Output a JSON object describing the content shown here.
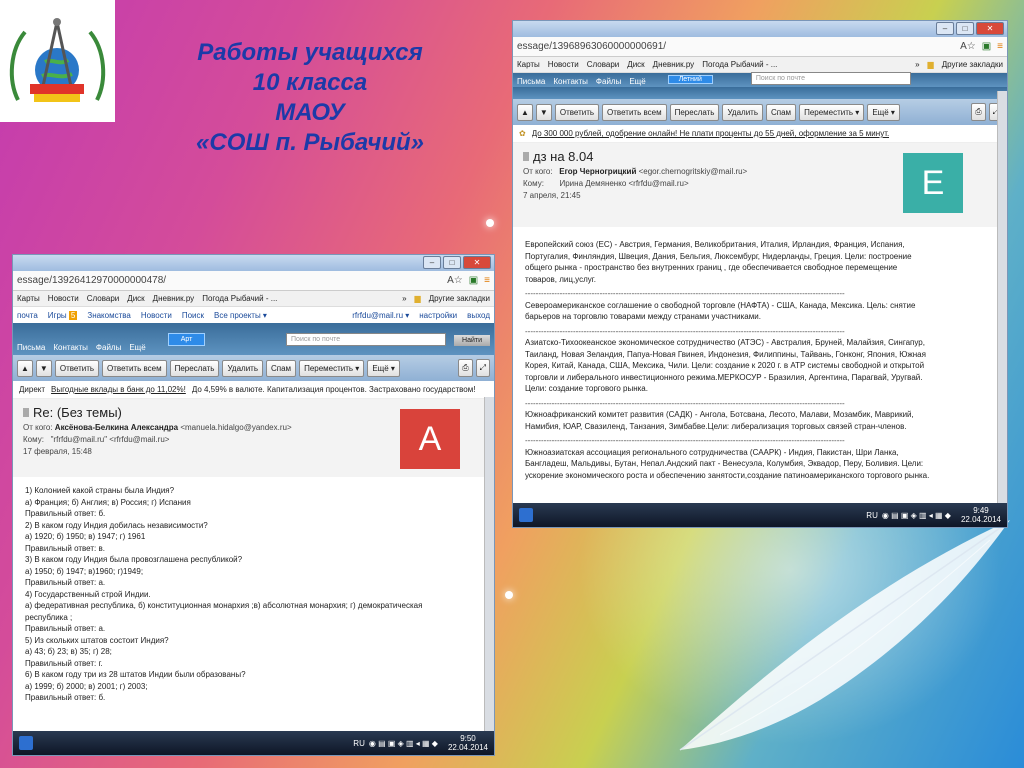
{
  "slide": {
    "title_lines": [
      "Работы  учащихся",
      "10 класса",
      "МАОУ",
      "«СОШ  п. Рыбачий»"
    ]
  },
  "icons": {
    "logo": "school-compass-globe-logo",
    "feather": "feather-decoration",
    "minimize": "minimize-icon",
    "maximize": "maximize-icon",
    "close": "close-icon",
    "star": "bookmark-star-icon",
    "menu": "menu-icon",
    "folder": "folder-icon"
  },
  "colors": {
    "avatar_a": "#d9433b",
    "avatar_e": "#3aafa7",
    "title": "#1c3aa8"
  },
  "win_left": {
    "url": "essage/13926412970000000478/",
    "url_icons": "A☆",
    "bookmarks": [
      "Карты",
      "Новости",
      "Словари",
      "Диск",
      "Дневник.ру",
      "Погода Рыбачий - ..."
    ],
    "bookmarks_more": "»",
    "other_bookmarks": "Другие закладки",
    "nav": [
      "почта",
      "Игры",
      "Знакомства",
      "Новости",
      "Поиск",
      "Все проекты ▾"
    ],
    "nav_games_badge": "5",
    "nav_right": [
      "rfrfdu@mail.ru ▾",
      "настройки",
      "выход"
    ],
    "tabs": [
      "Письма",
      "Контакты",
      "Файлы",
      "Ещё"
    ],
    "tab_badge": "Арт",
    "search_placeholder": "Поиск по почте",
    "search_btn": "Найти",
    "toolbar": [
      "Ответить",
      "Ответить всем",
      "Переслать",
      "Удалить",
      "Спам",
      "Переместить ▾",
      "Ещё ▾"
    ],
    "ad_label": "Директ",
    "ad_text": "Выгодные вклады в банк до 11,02%!",
    "ad_text2": "До 4,59% в валюте. Капитализация процентов. Застраховано государством!",
    "subject": "Re: (Без темы)",
    "from_label": "От кого:",
    "from_name": "Аксёнова-Белкина Александра",
    "from_email": "<manuela.hidalgo@yandex.ru>",
    "to_label": "Кому:",
    "to_value": "\"rfrfdu@mail.ru\" <rfrfdu@mail.ru>",
    "date": "17 февраля, 15:48",
    "avatar": "A",
    "body": [
      "1) Колонией какой страны была Индия?",
      "а) Франция; б) Англия; в) Россия; г) Испания",
      "Правильный ответ: б.",
      "2) В каком году Индия добилась независимости?",
      "а) 1920; б) 1950; в) 1947; г) 1961",
      "Правильный ответ: в.",
      "3) В каком году Индия была провозглашена республикой?",
      "а) 1950; б) 1947; в)1960; г)1949;",
      "Правильный ответ: а.",
      "4) Государственный строй Индии.",
      "а) федеративная республика, б) конституционная монархия ;в) абсолютная монархия; г) демократическая",
      "республика ;",
      "Правильный ответ: а.",
      "5) Из скольких штатов состоит Индия?",
      "а) 43; б) 23; в) 35; г) 28;",
      "Правильный ответ: г.",
      "6) В каком году три из 28 штатов Индии были образованы?",
      "а) 1999; б) 2000; в) 2001; г) 2003;",
      "Правильный ответ: б."
    ],
    "lang": "RU",
    "time": "9:50",
    "date_taskbar": "22.04.2014"
  },
  "win_right": {
    "url": "essage/13968963060000000691/",
    "url_icons": "A☆",
    "bookmarks": [
      "Карты",
      "Новости",
      "Словари",
      "Диск",
      "Дневник.ру",
      "Погода Рыбачий - ..."
    ],
    "bookmarks_more": "»",
    "other_bookmarks": "Другие закладки",
    "tabs": [
      "Письма",
      "Контакты",
      "Файлы",
      "Ещё"
    ],
    "tab_badge": "Летний",
    "search_placeholder": "Поиск по почте",
    "toolbar": [
      "Ответить",
      "Ответить всем",
      "Переслать",
      "Удалить",
      "Спам",
      "Переместить ▾",
      "Ещё ▾"
    ],
    "ad_text": "До 300 000 рублей, одобрение онлайн! Не плати проценты до 55 дней, оформление за 5 минут.",
    "subject": "дз на 8.04",
    "from_label": "От кого:",
    "from_name": "Егор Черногрицкий",
    "from_email": "<egor.chernogritskiy@mail.ru>",
    "to_label": "Кому:",
    "to_value": "Ирина Демяненко <rfrfdu@mail.ru>",
    "date": "7 апреля, 21:45",
    "avatar": "E",
    "paragraphs": [
      [
        "Европейский союз (ЕС) - Австрия, Германия, Великобритания, Италия, Ирландия, Франция, Испания,",
        "Португалия, Финляндия, Швеция, Дания, Бельгия, Люксембург, Нидерланды, Греция. Цели: построение",
        "общего рынка - пространство без внутренних границ , где обеспечивается свободное перемещение",
        "товаров, лиц,услуг."
      ],
      [
        "Североамериканское соглашение о свободной торговле (НАФТА) - США, Канада, Мексика. Цель: снятие",
        "барьеров на торговлю товарами между странами участниками."
      ],
      [
        "Азиатско-Тихоокеанское экономическое сотрудничество (АТЭС) - Австралия, Бруней, Малайзия, Сингапур,",
        "Таиланд, Новая Зеландия, Папуа-Новая Гвинея, Индонезия, Филиппины, Тайвань, Гонконг, Япония, Южная",
        "Корея, Китай, Канада, США, Мексика, Чили. Цели: создание к 2020 г. в АТР системы свободной и открытой",
        "торговли и либерального инвестиционного режима.МЕРКОСУР - Бразилия, Аргентина, Парагвай, Уругвай.",
        "Цели: создание торгового рынка."
      ],
      [
        "Южноафриканский комитет развития (САДК) - Ангола, Ботсвана, Лесото, Малави, Мозамбик, Маврикий,",
        "Намибия, ЮАР, Свазиленд, Танзания, Зимбабве.Цели: либерализация торговых связей стран-членов."
      ],
      [
        "Южноазиатская ассоциация регионального сотрудничества (СААРК) - Индия, Пакистан, Шри Ланка,",
        "Бангладеш, Мальдивы, Бутан, Непал.Андский пакт - Венесуэла, Колумбия, Эквадор, Перу, Боливия. Цели:",
        "ускорение экономического роста и обеспечению занятости,создание патиноамериканского торгового рынка."
      ]
    ],
    "separator": "------------------------------------------------------------------------------------------------------------------------",
    "lang": "RU",
    "time": "9:49",
    "date_taskbar": "22.04.2014"
  }
}
